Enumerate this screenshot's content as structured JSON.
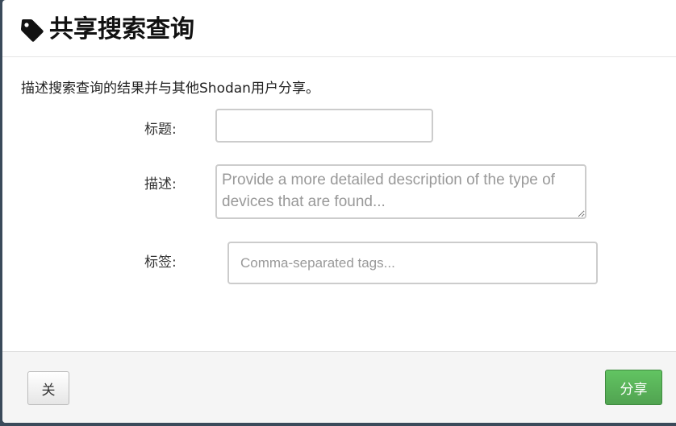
{
  "modal": {
    "title": "共享搜索查询",
    "title_icon": "tag-icon",
    "description": "描述搜索查询的结果并与其他Shodan用户分享。"
  },
  "form": {
    "title_label": "标题:",
    "title_value": "",
    "description_label": "描述:",
    "description_placeholder": "Provide a more detailed description of the type of devices that are found...",
    "tags_label": "标签:",
    "tags_placeholder": "Comma-separated tags..."
  },
  "footer": {
    "close_label": "关",
    "share_label": "分享"
  },
  "colors": {
    "share_button": "#51a351",
    "footer_background": "#f5f5f5"
  }
}
